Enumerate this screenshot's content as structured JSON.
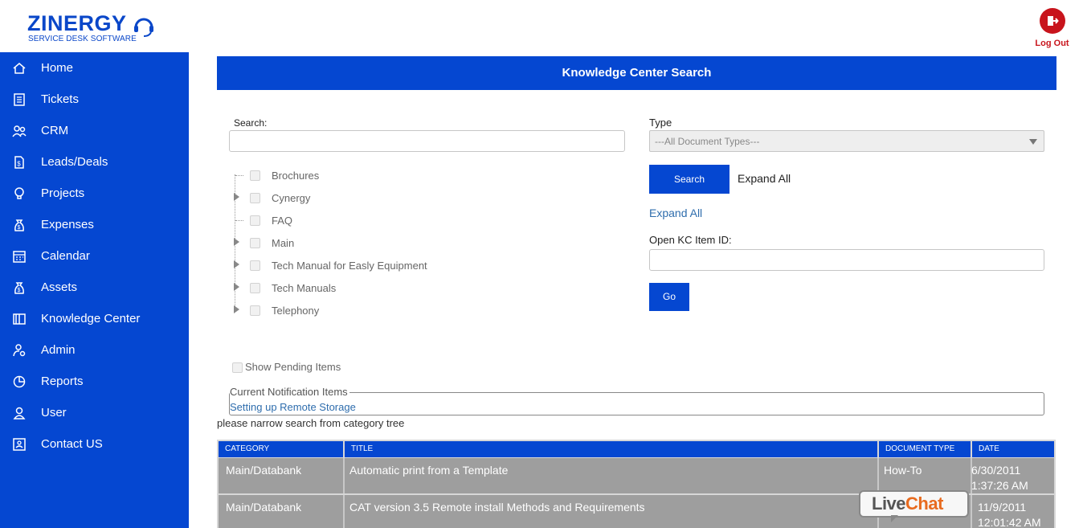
{
  "brand": {
    "name": "ZINERGY",
    "tagline": "SERVICE DESK SOFTWARE",
    "color": "#0a47c9"
  },
  "header": {
    "logout_label": "Log Out",
    "logout_color": "#c8141c"
  },
  "sidebar": {
    "color": "#0547d1",
    "items": [
      {
        "label": "Home",
        "icon": "home-icon"
      },
      {
        "label": "Tickets",
        "icon": "ticket-icon"
      },
      {
        "label": "CRM",
        "icon": "users-icon"
      },
      {
        "label": "Leads/Deals",
        "icon": "dollar-doc-icon"
      },
      {
        "label": "Projects",
        "icon": "lightbulb-icon"
      },
      {
        "label": "Expenses",
        "icon": "money-bag-icon"
      },
      {
        "label": "Calendar",
        "icon": "calendar-icon"
      },
      {
        "label": "Assets",
        "icon": "asset-bag-icon"
      },
      {
        "label": "Knowledge Center",
        "icon": "book-icon"
      },
      {
        "label": "Admin",
        "icon": "admin-user-icon"
      },
      {
        "label": "Reports",
        "icon": "pie-chart-icon"
      },
      {
        "label": "User",
        "icon": "user-icon"
      },
      {
        "label": "Contact US",
        "icon": "contact-card-icon"
      }
    ]
  },
  "main": {
    "title": "Knowledge Center Search",
    "search_label": "Search:",
    "search_value": "",
    "tree": [
      {
        "label": "Brochures",
        "expandable": false
      },
      {
        "label": "Cynergy",
        "expandable": true
      },
      {
        "label": "FAQ",
        "expandable": false
      },
      {
        "label": "Main",
        "expandable": true
      },
      {
        "label": "Tech Manual for Easly Equipment",
        "expandable": true
      },
      {
        "label": "Tech Manuals",
        "expandable": true
      },
      {
        "label": "Telephony",
        "expandable": true
      }
    ],
    "type_label": "Type",
    "type_selected": "---All Document Types---",
    "search_button": "Search",
    "expand_all_text": "Expand All",
    "expand_all_link": "Expand All",
    "kc_item_label": "Open KC Item ID:",
    "kc_item_value": "",
    "go_button": "Go",
    "show_pending_label": "Show Pending Items",
    "notification_legend": "Current Notification Items",
    "notification_link": "Setting up Remote Storage",
    "narrow_message": "please narrow search from category tree"
  },
  "table": {
    "columns": [
      "CATEGORY",
      "TITLE",
      "DOCUMENT TYPE",
      "DATE"
    ],
    "rows": [
      {
        "category": "Main/Databank",
        "title": "Automatic print from a Template",
        "doc_type": "How-To",
        "date": "6/30/2011",
        "time": "1:37:26 AM"
      },
      {
        "category": "Main/Databank",
        "title": "CAT version 3.5 Remote install Methods and Requirements",
        "doc_type": "",
        "date": "11/9/2011",
        "time": "12:01:42 AM"
      }
    ]
  },
  "livechat": {
    "live": "Live",
    "chat": "Chat"
  }
}
